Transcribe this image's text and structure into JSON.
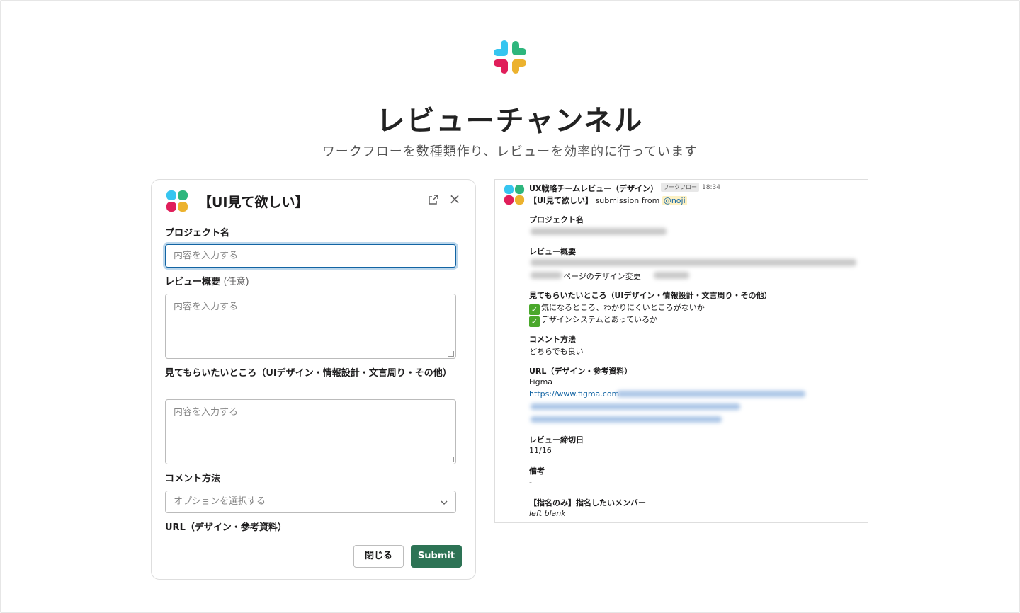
{
  "hero": {
    "title": "レビューチャンネル",
    "subtitle": "ワークフローを数種類作り、レビューを効率的に行っています",
    "logo_icon": "slack-logo-icon"
  },
  "modal": {
    "title": "【UI見て欲しい】",
    "fields": [
      {
        "label": "プロジェクト名",
        "placeholder": "内容を入力する"
      },
      {
        "label": "レビュー概要",
        "optional": "(任意)",
        "placeholder": "内容を入力する"
      },
      {
        "label": "見てもらいたいところ（UIデザイン・情報設計・文言周り・その他）",
        "placeholder": "内容を入力する"
      },
      {
        "label": "コメント方法",
        "placeholder": "オプションを選択する"
      },
      {
        "label": "URL（デザイン・参考資料）"
      }
    ],
    "close_label": "閉じる",
    "submit_label": "Submit",
    "colors": {
      "submit": "#2d7355",
      "focus": "#1264a3"
    }
  },
  "message": {
    "sender": "UX戦略チームレビュー（デザイン）",
    "badge": "ワークフロー",
    "time": "18:34",
    "title": "【UI見て欲しい】",
    "submission_text": "submission from",
    "mention": "@noji",
    "sections": [
      {
        "heading": "プロジェクト名"
      },
      {
        "heading": "レビュー概要",
        "value": "ページのデザイン変更"
      },
      {
        "heading": "見てもらいたいところ（UIデザイン・情報設計・文言周り・その他）",
        "items": [
          "気になるところ、わかりにくいところがないか",
          "デザインシステムとあっているか"
        ]
      },
      {
        "heading": "コメント方法",
        "value": "どちらでも良い"
      },
      {
        "heading": "URL（デザイン・参考資料）",
        "value": "Figma",
        "link": "https://www.figma.com"
      },
      {
        "heading": "レビュー締切日",
        "value": "11/16"
      },
      {
        "heading": "備考",
        "value": "-"
      },
      {
        "heading": "【指名のみ】指名したいメンバー",
        "value": "left blank"
      }
    ]
  }
}
